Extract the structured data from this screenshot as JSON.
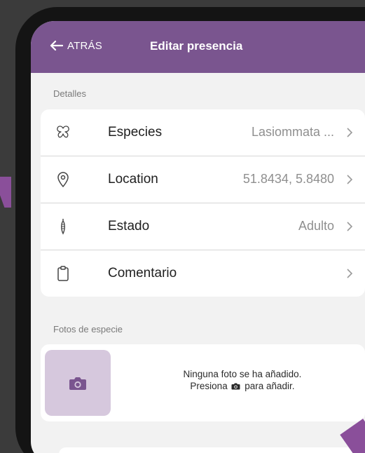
{
  "colors": {
    "header": "#7a558f",
    "accent": "#8a4f9a",
    "placeholder": "#d6c8dd"
  },
  "header": {
    "back_icon": "arrow-left-icon",
    "back_label": "ATRÁS",
    "title": "Editar presencia"
  },
  "details": {
    "section_label": "Detalles",
    "rows": [
      {
        "icon": "butterfly-icon",
        "label": "Especies",
        "value": "Lasiommata ..."
      },
      {
        "icon": "location-pin-icon",
        "label": "Location",
        "value": "51.8434, 5.8480"
      },
      {
        "icon": "chrysalis-icon",
        "label": "Estado",
        "value": "Adulto"
      },
      {
        "icon": "clipboard-icon",
        "label": "Comentario",
        "value": ""
      }
    ]
  },
  "photos": {
    "section_label": "Fotos de especie",
    "add_icon": "camera-icon",
    "empty_line1": "Ninguna foto se ha añadido.",
    "empty_line2_pre": "Presiona",
    "empty_line2_post": "para añadir."
  }
}
